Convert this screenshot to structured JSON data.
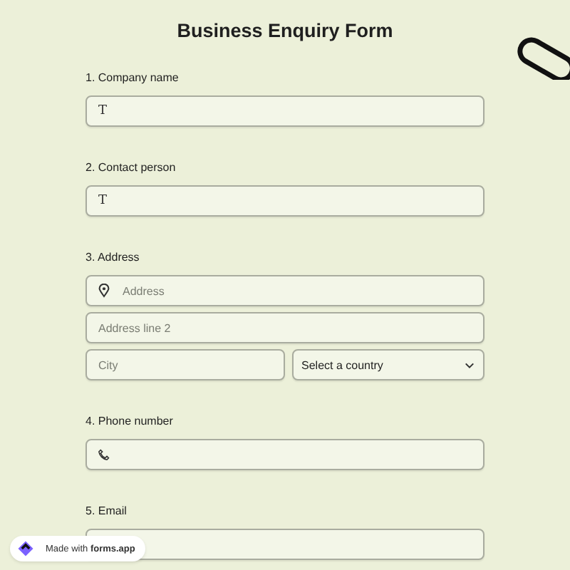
{
  "title": "Business Enquiry Form",
  "questions": [
    {
      "label": "1. Company name",
      "rows": [
        [
          {
            "kind": "text",
            "icon": "T"
          }
        ]
      ]
    },
    {
      "label": "2. Contact person",
      "rows": [
        [
          {
            "kind": "text",
            "icon": "T"
          }
        ]
      ]
    },
    {
      "label": "3. Address",
      "rows": [
        [
          {
            "kind": "location",
            "placeholder": "Address"
          }
        ],
        [
          {
            "kind": "plain",
            "placeholder": "Address line 2"
          }
        ],
        [
          {
            "kind": "plain",
            "placeholder": "City"
          },
          {
            "kind": "select",
            "value": "Select a country"
          }
        ]
      ]
    },
    {
      "label": "4. Phone number",
      "rows": [
        [
          {
            "kind": "phone"
          }
        ]
      ]
    },
    {
      "label": "5. Email",
      "rows": [
        [
          {
            "kind": "plain"
          }
        ]
      ]
    }
  ],
  "badge": {
    "text": "Made with **forms.app**"
  }
}
